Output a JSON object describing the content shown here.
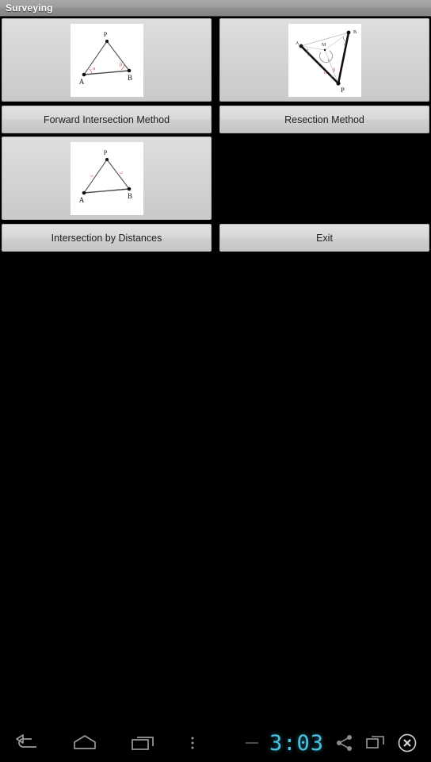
{
  "titlebar": {
    "title": "Surveying"
  },
  "grid": {
    "rows": [
      {
        "cells": [
          {
            "image_name": "forward-intersection-diagram",
            "label": "Forward Intersection Method",
            "diagram": {
              "points": [
                "P",
                "A",
                "B"
              ],
              "angle_labels": [
                "α",
                "β"
              ]
            }
          },
          {
            "image_name": "resection-diagram",
            "label": "Resection Method",
            "diagram": {
              "points": [
                "A",
                "B",
                "M",
                "P"
              ],
              "angle_labels": [
                "ψ",
                "φ",
                "γ",
                "α",
                "β"
              ]
            }
          }
        ]
      },
      {
        "cells": [
          {
            "image_name": "intersection-by-distances-diagram",
            "label": "Intersection by Distances",
            "diagram": {
              "points": [
                "P",
                "A",
                "B"
              ],
              "angle_labels": [
                "s1",
                "s2"
              ]
            }
          },
          {
            "image_name": "none",
            "label": "Exit",
            "diagram": null
          }
        ]
      }
    ]
  },
  "navbar": {
    "back_label": "Back",
    "home_label": "Home",
    "recents_label": "Recent apps",
    "menu_label": "Menu",
    "clock": "3:03",
    "share_label": "Share",
    "window_label": "Window",
    "close_label": "Close"
  },
  "colors": {
    "accent_clock": "#49c4e6",
    "button_face": "#d8d8d8",
    "titlebar": "#9c9c9c",
    "angle_red": "#d05050",
    "background": "#000000"
  }
}
